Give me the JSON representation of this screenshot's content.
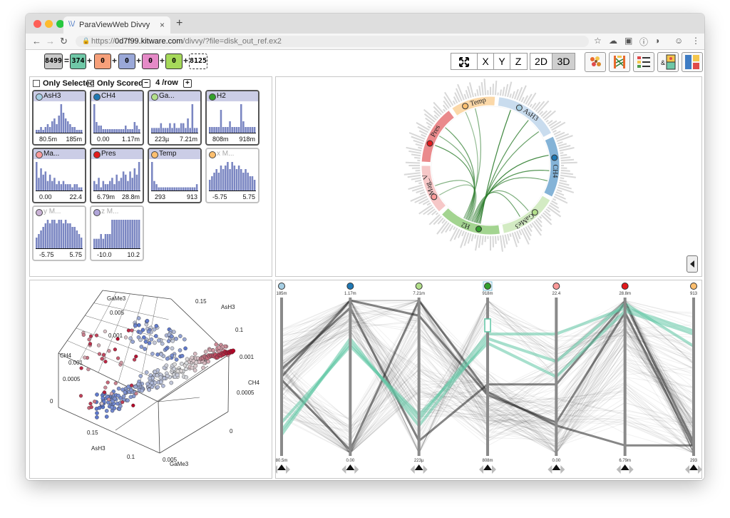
{
  "browser": {
    "tab_title": "ParaViewWeb Divvy",
    "tab_close": "×",
    "new_tab": "+",
    "url_protocol": "https://",
    "url_domain": "0d7f99.kitware.com",
    "url_path": "/divvy/?file=disk_out_ref.ex2",
    "colors": {
      "close": "#fe5f57",
      "minimize": "#febb2e",
      "maximize": "#28c840"
    }
  },
  "toolbar": {
    "selection_counts": [
      {
        "value": "8499",
        "color": "#c9c9c9"
      },
      {
        "value": "374",
        "color": "#6fc8a7"
      },
      {
        "value": "0",
        "color": "#f6a07a"
      },
      {
        "value": "0",
        "color": "#9aa8d8"
      },
      {
        "value": "0",
        "color": "#e58ac7"
      },
      {
        "value": "0",
        "color": "#a6d95a"
      }
    ],
    "equals": "=",
    "plus": "+",
    "total_unselected": "8125",
    "view_buttons": [
      "X",
      "Y",
      "Z"
    ],
    "dim_buttons": [
      "2D",
      "3D"
    ],
    "active_dim": "3D",
    "fullscreen_icon": "expand-arrows-icon",
    "tool_icons": [
      "scatter-config-icon",
      "parallel-coords-icon",
      "field-list-icon",
      "selection-editor-icon",
      "layout-icon"
    ]
  },
  "histograms": {
    "only_selected": "Only Selected",
    "only_scored": "Only Scored",
    "per_row": "4 /row",
    "decrease": "−",
    "increase": "+",
    "items": [
      {
        "name": "AsH3",
        "min": "80.5m",
        "max": "185m",
        "color": "#a6cee3",
        "active": true,
        "bars": [
          1,
          1,
          2,
          1,
          2,
          3,
          2,
          4,
          5,
          3,
          6,
          10,
          7,
          5,
          4,
          3,
          2,
          2,
          1,
          1,
          1
        ]
      },
      {
        "name": "CH4",
        "min": "0.00",
        "max": "1.17m",
        "color": "#1f78b4",
        "active": true,
        "bars": [
          8,
          3,
          2,
          2,
          1,
          1,
          1,
          1,
          1,
          1,
          1,
          1,
          1,
          1,
          2,
          1,
          1,
          1,
          3,
          2,
          1
        ]
      },
      {
        "name": "Ga...",
        "min": "223µ",
        "max": "7.21m",
        "color": "#b2df8a",
        "active": true,
        "bars": [
          1,
          1,
          1,
          1,
          2,
          1,
          1,
          1,
          2,
          1,
          2,
          1,
          1,
          2,
          2,
          1,
          3,
          1,
          6,
          1,
          1
        ]
      },
      {
        "name": "H2",
        "min": "808m",
        "max": "918m",
        "color": "#33a02c",
        "active": true,
        "bars": [
          1,
          1,
          1,
          1,
          1,
          4,
          1,
          1,
          1,
          2,
          1,
          1,
          1,
          1,
          5,
          2,
          1,
          1,
          1,
          1,
          1
        ]
      },
      {
        "name": "Ma...",
        "min": "0.00",
        "max": "22.4",
        "color": "#fb9a99",
        "active": true,
        "bars": [
          9,
          4,
          7,
          5,
          6,
          3,
          5,
          3,
          4,
          2,
          3,
          2,
          3,
          2,
          2,
          2,
          1,
          2,
          2,
          1,
          1
        ]
      },
      {
        "name": "Pres",
        "min": "6.79m",
        "max": "28.8m",
        "color": "#e31a1c",
        "active": true,
        "bars": [
          3,
          2,
          4,
          1,
          3,
          2,
          2,
          3,
          4,
          2,
          5,
          3,
          4,
          6,
          5,
          3,
          6,
          4,
          7,
          5,
          9
        ]
      },
      {
        "name": "Temp",
        "min": "293",
        "max": "913",
        "color": "#fdbf6f",
        "active": true,
        "bars": [
          9,
          3,
          2,
          1,
          1,
          1,
          1,
          1,
          1,
          1,
          1,
          1,
          1,
          1,
          1,
          1,
          1,
          1,
          1,
          1,
          2
        ]
      },
      {
        "name": "x M...",
        "min": "-5.75",
        "max": "5.75",
        "color": "#fdbf6f",
        "active": false,
        "bars": [
          3,
          4,
          5,
          6,
          5,
          7,
          6,
          7,
          8,
          6,
          8,
          7,
          6,
          7,
          6,
          5,
          6,
          5,
          4,
          4,
          3
        ]
      },
      {
        "name": "y M...",
        "min": "-5.75",
        "max": "5.75",
        "color": "#cab2d6",
        "active": false,
        "bars": [
          3,
          4,
          5,
          6,
          7,
          8,
          7,
          8,
          8,
          7,
          8,
          8,
          7,
          8,
          7,
          7,
          6,
          6,
          5,
          4,
          3
        ]
      },
      {
        "name": "z M...",
        "min": "-10.0",
        "max": "10.2",
        "color": "#b0a5d9",
        "active": false,
        "bars": [
          2,
          2,
          2,
          3,
          2,
          3,
          3,
          3,
          6,
          6,
          6,
          6,
          6,
          6,
          6,
          6,
          6,
          6,
          6,
          6,
          6
        ]
      }
    ]
  },
  "chord": {
    "segments": [
      "AsH3",
      "CH4",
      "GaMe3",
      "H2",
      "Mag_V",
      "Pres",
      "Temp"
    ],
    "segment_colors": [
      "#c9dcee",
      "#84b3d7",
      "#d3ebc3",
      "#a3d490",
      "#f6c7c7",
      "#ea8a8c",
      "#fbd8a8"
    ],
    "dot_colors": [
      "#a6cee3",
      "#1f78b4",
      "#b2df8a",
      "#33a02c",
      "#fb9a99",
      "#e31a1c",
      "#fdbf6f"
    ],
    "link_color": "#2c7c2c",
    "toggle_icon": "triangle-left-icon"
  },
  "scatter3d": {
    "axes": [
      {
        "label": "GaMe3",
        "ticks": [
          "0.005",
          "0.001"
        ]
      },
      {
        "label": "AsH3",
        "ticks": [
          "0.15",
          "0.1"
        ]
      },
      {
        "label": "CH4",
        "ticks": [
          "0.001",
          "0.0005",
          "0"
        ]
      },
      {
        "label": "CH4",
        "ticks": [
          "0.001",
          "0.0005",
          "0"
        ]
      },
      {
        "label": "AsH3",
        "ticks": [
          "0.15",
          "0.1"
        ]
      },
      {
        "label": "GaMe3",
        "ticks": [
          "0.005"
        ]
      }
    ],
    "colors": {
      "low": "#3a5cc7",
      "mid": "#dcdcdc",
      "high": "#b40426"
    }
  },
  "parallel": {
    "axes": [
      {
        "top": "185m",
        "bottom": "80.5m",
        "color": "#a6cee3"
      },
      {
        "top": "1.17m",
        "bottom": "0.00",
        "color": "#1f78b4"
      },
      {
        "top": "7.21m",
        "bottom": "223µ",
        "color": "#b2df8a"
      },
      {
        "top": "918m",
        "bottom": "808m",
        "color": "#33a02c"
      },
      {
        "top": "22.4",
        "bottom": "0.00",
        "color": "#fb9a99"
      },
      {
        "top": "28.8m",
        "bottom": "6.79m",
        "color": "#e31a1c"
      },
      {
        "top": "913",
        "bottom": "293",
        "color": "#fdbf6f"
      }
    ],
    "selection_color": "#5fc6a4",
    "line_color": "#000000"
  }
}
